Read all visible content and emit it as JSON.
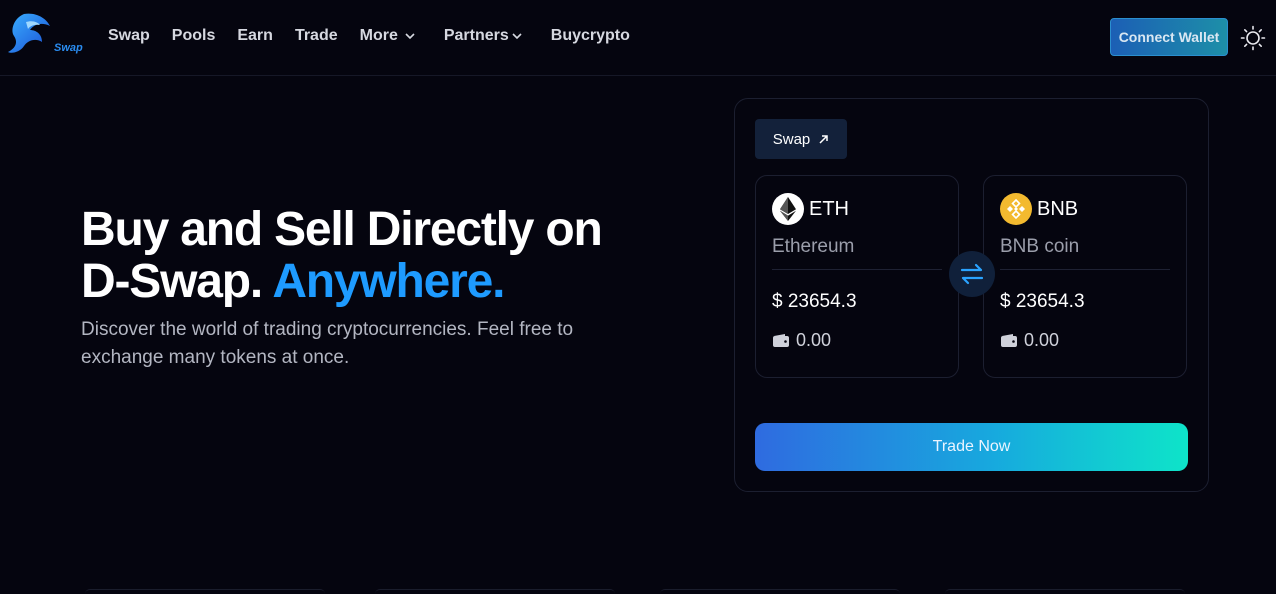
{
  "brand": {
    "logo_text": "Swap",
    "accent_color": "#1e9bff"
  },
  "nav": {
    "items": [
      {
        "label": "Swap",
        "has_chevron": false
      },
      {
        "label": "Pools",
        "has_chevron": false
      },
      {
        "label": "Earn",
        "has_chevron": false
      },
      {
        "label": "Trade",
        "has_chevron": false
      },
      {
        "label": "More",
        "has_chevron": true
      },
      {
        "label": "Partners",
        "has_chevron": true
      },
      {
        "label": "Buycrypto",
        "has_chevron": false
      }
    ],
    "connect_label": "Connect Wallet",
    "theme_icon": "sun-icon"
  },
  "hero": {
    "title_line1": "Buy and Sell Directly on",
    "title_line2": "D-Swap.",
    "title_accent": "Anywhere.",
    "subtitle": "Discover the world of trading cryptocurrencies. Feel free to exchange many tokens at once."
  },
  "swap_panel": {
    "tab_label": "Swap",
    "tab_icon": "arrow-up-right-icon",
    "from": {
      "symbol": "ETH",
      "name": "Ethereum",
      "price": "$ 23654.3",
      "balance": "0.00",
      "icon": "ethereum-icon"
    },
    "to": {
      "symbol": "BNB",
      "name": "BNB coin",
      "price": "$ 23654.3",
      "balance": "0.00",
      "icon": "bnb-icon"
    },
    "swap_icon": "swap-arrows-icon",
    "trade_label": "Trade Now"
  }
}
